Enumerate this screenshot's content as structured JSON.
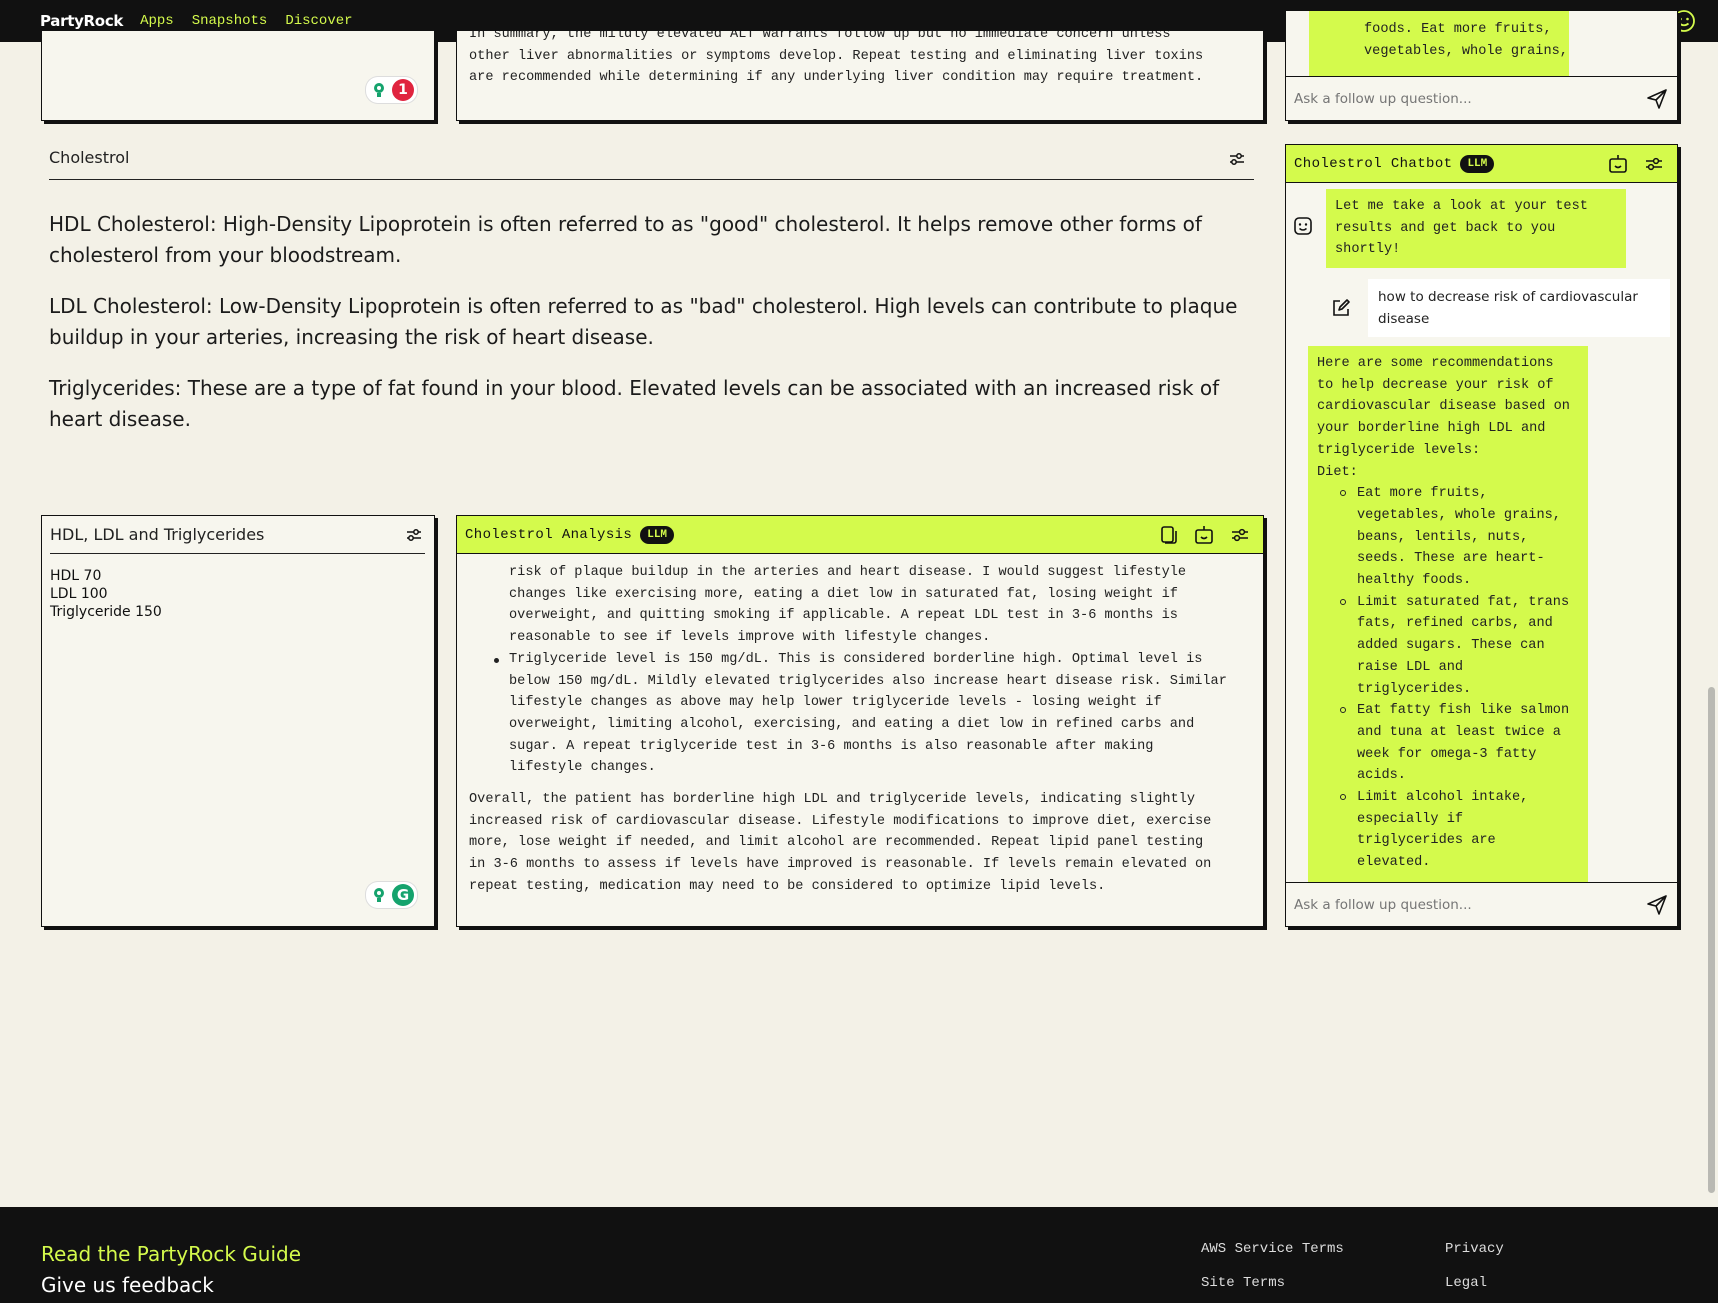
{
  "nav": {
    "brand": "PartyRock",
    "links": [
      "Apps",
      "Snapshots",
      "Discover"
    ]
  },
  "top_cards": {
    "liver_tail": [
      "In summary, the mildly elevated ALT warrants follow up but no immediate concern unless",
      "other liver abnormalities or symptoms develop. Repeat testing and eliminating liver toxins",
      "are recommended while determining if any underlying liver condition may require treatment."
    ],
    "chip_count": "1",
    "top_chat_tail": [
      "foods. Eat more fruits,",
      "vegetables, whole grains,"
    ],
    "top_chat_placeholder": "Ask a follow up question..."
  },
  "cholestrol_section": {
    "title": "Cholestrol",
    "paragraphs": [
      "HDL Cholesterol: High-Density Lipoprotein is often referred to as \"good\" cholesterol. It helps remove other forms of cholesterol from your bloodstream.",
      "LDL Cholesterol: Low-Density Lipoprotein is often referred to as \"bad\" cholesterol. High levels can contribute to plaque buildup in your arteries, increasing the risk of heart disease.",
      "Triglycerides: These are a type of fat found in your blood. Elevated levels can be associated with an increased risk of heart disease."
    ]
  },
  "hdl_panel": {
    "title": "HDL, LDL and Triglycerides",
    "lines": [
      "HDL 70",
      "LDL 100",
      "Triglyceride 150"
    ],
    "chip_letter": "G"
  },
  "analysis": {
    "title": "Cholestrol Analysis",
    "badge": "LLM",
    "bullet_cont_lines": [
      "risk of plaque buildup in the arteries and heart disease. I would suggest lifestyle",
      "changes like exercising more, eating a diet low in saturated fat, losing weight if",
      "overweight, and quitting smoking if applicable. A repeat LDL test in 3-6 months is",
      "reasonable to see if levels improve with lifestyle changes."
    ],
    "bullet_trig_lines": [
      "Triglyceride level is 150 mg/dL. This is considered borderline high. Optimal level is",
      "below 150 mg/dL. Mildly elevated triglycerides also increase heart disease risk. Similar",
      "lifestyle changes as above may help lower triglyceride levels - losing weight if",
      "overweight, limiting alcohol, exercising, and eating a diet low in refined carbs and",
      "sugar. A repeat triglyceride test in 3-6 months is also reasonable after making",
      "lifestyle changes."
    ],
    "overall_lines": [
      "Overall, the patient has borderline high LDL and triglyceride levels, indicating slightly",
      "increased risk of cardiovascular disease. Lifestyle modifications to improve diet, exercise",
      "more, lose weight if needed, and limit alcohol are recommended. Repeat lipid panel testing",
      "in 3-6 months to assess if levels have improved is reasonable. If levels remain elevated on",
      "repeat testing, medication may need to be considered to optimize lipid levels."
    ]
  },
  "chatbot": {
    "title": "Cholestrol Chatbot",
    "badge": "LLM",
    "bot_msg_1": [
      "Let me take a look at your test",
      "results and get back to you",
      "shortly!"
    ],
    "user_msg": [
      "how to decrease risk of cardiovascular",
      "disease"
    ],
    "bot_msg_2_intro": [
      "Here are some recommendations",
      "to help decrease your risk of",
      "cardiovascular disease based on",
      "your borderline high LDL and",
      "triglyceride levels:",
      "Diet:"
    ],
    "bot_msg_2_items": [
      [
        "Eat more fruits,",
        "vegetables, whole grains,",
        "beans, lentils, nuts,",
        "seeds. These are heart-",
        "healthy foods."
      ],
      [
        "Limit saturated fat, trans",
        "fats, refined carbs, and",
        "added sugars. These can",
        "raise LDL and",
        "triglycerides."
      ],
      [
        "Eat fatty fish like salmon",
        "and tuna at least twice a",
        "week for omega-3 fatty",
        "acids."
      ],
      [
        "Limit alcohol intake,",
        "especially if",
        "triglycerides are",
        "elevated."
      ]
    ],
    "placeholder": "Ask a follow up question..."
  },
  "footer": {
    "guide": "Read the PartyRock Guide",
    "feedback": "Give us feedback",
    "aws_terms": "AWS Service Terms",
    "site_terms": "Site Terms",
    "privacy": "Privacy",
    "legal": "Legal"
  },
  "colors": {
    "accent": "#d4fa4c",
    "dark": "#111111",
    "background": "#f3f1e7",
    "chip_red": "#e0243f",
    "chip_green": "#15a36d"
  }
}
